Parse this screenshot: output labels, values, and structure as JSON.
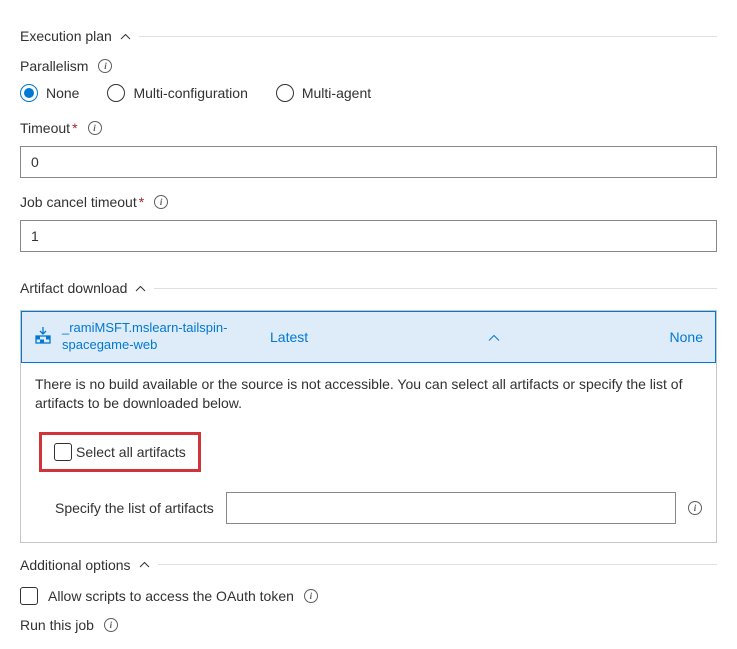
{
  "sections": {
    "execution": "Execution plan",
    "artifact": "Artifact download",
    "additional": "Additional options"
  },
  "parallelism": {
    "label": "Parallelism",
    "options": {
      "none": "None",
      "multi_config": "Multi-configuration",
      "multi_agent": "Multi-agent"
    },
    "selected": "none"
  },
  "timeout": {
    "label": "Timeout",
    "value": "0"
  },
  "job_cancel_timeout": {
    "label": "Job cancel timeout",
    "value": "1"
  },
  "artifact": {
    "name": "_ramiMSFT.mslearn-tailspin-spacegame-web",
    "version": "Latest",
    "selection": "None",
    "message": "There is no build available or the source is not accessible. You can select all artifacts or specify the list of artifacts to be downloaded below.",
    "select_all_label": "Select all artifacts",
    "specify_label": "Specify the list of artifacts",
    "specify_value": ""
  },
  "additional": {
    "allow_scripts_label": "Allow scripts to access the OAuth token",
    "run_job_label": "Run this job"
  }
}
